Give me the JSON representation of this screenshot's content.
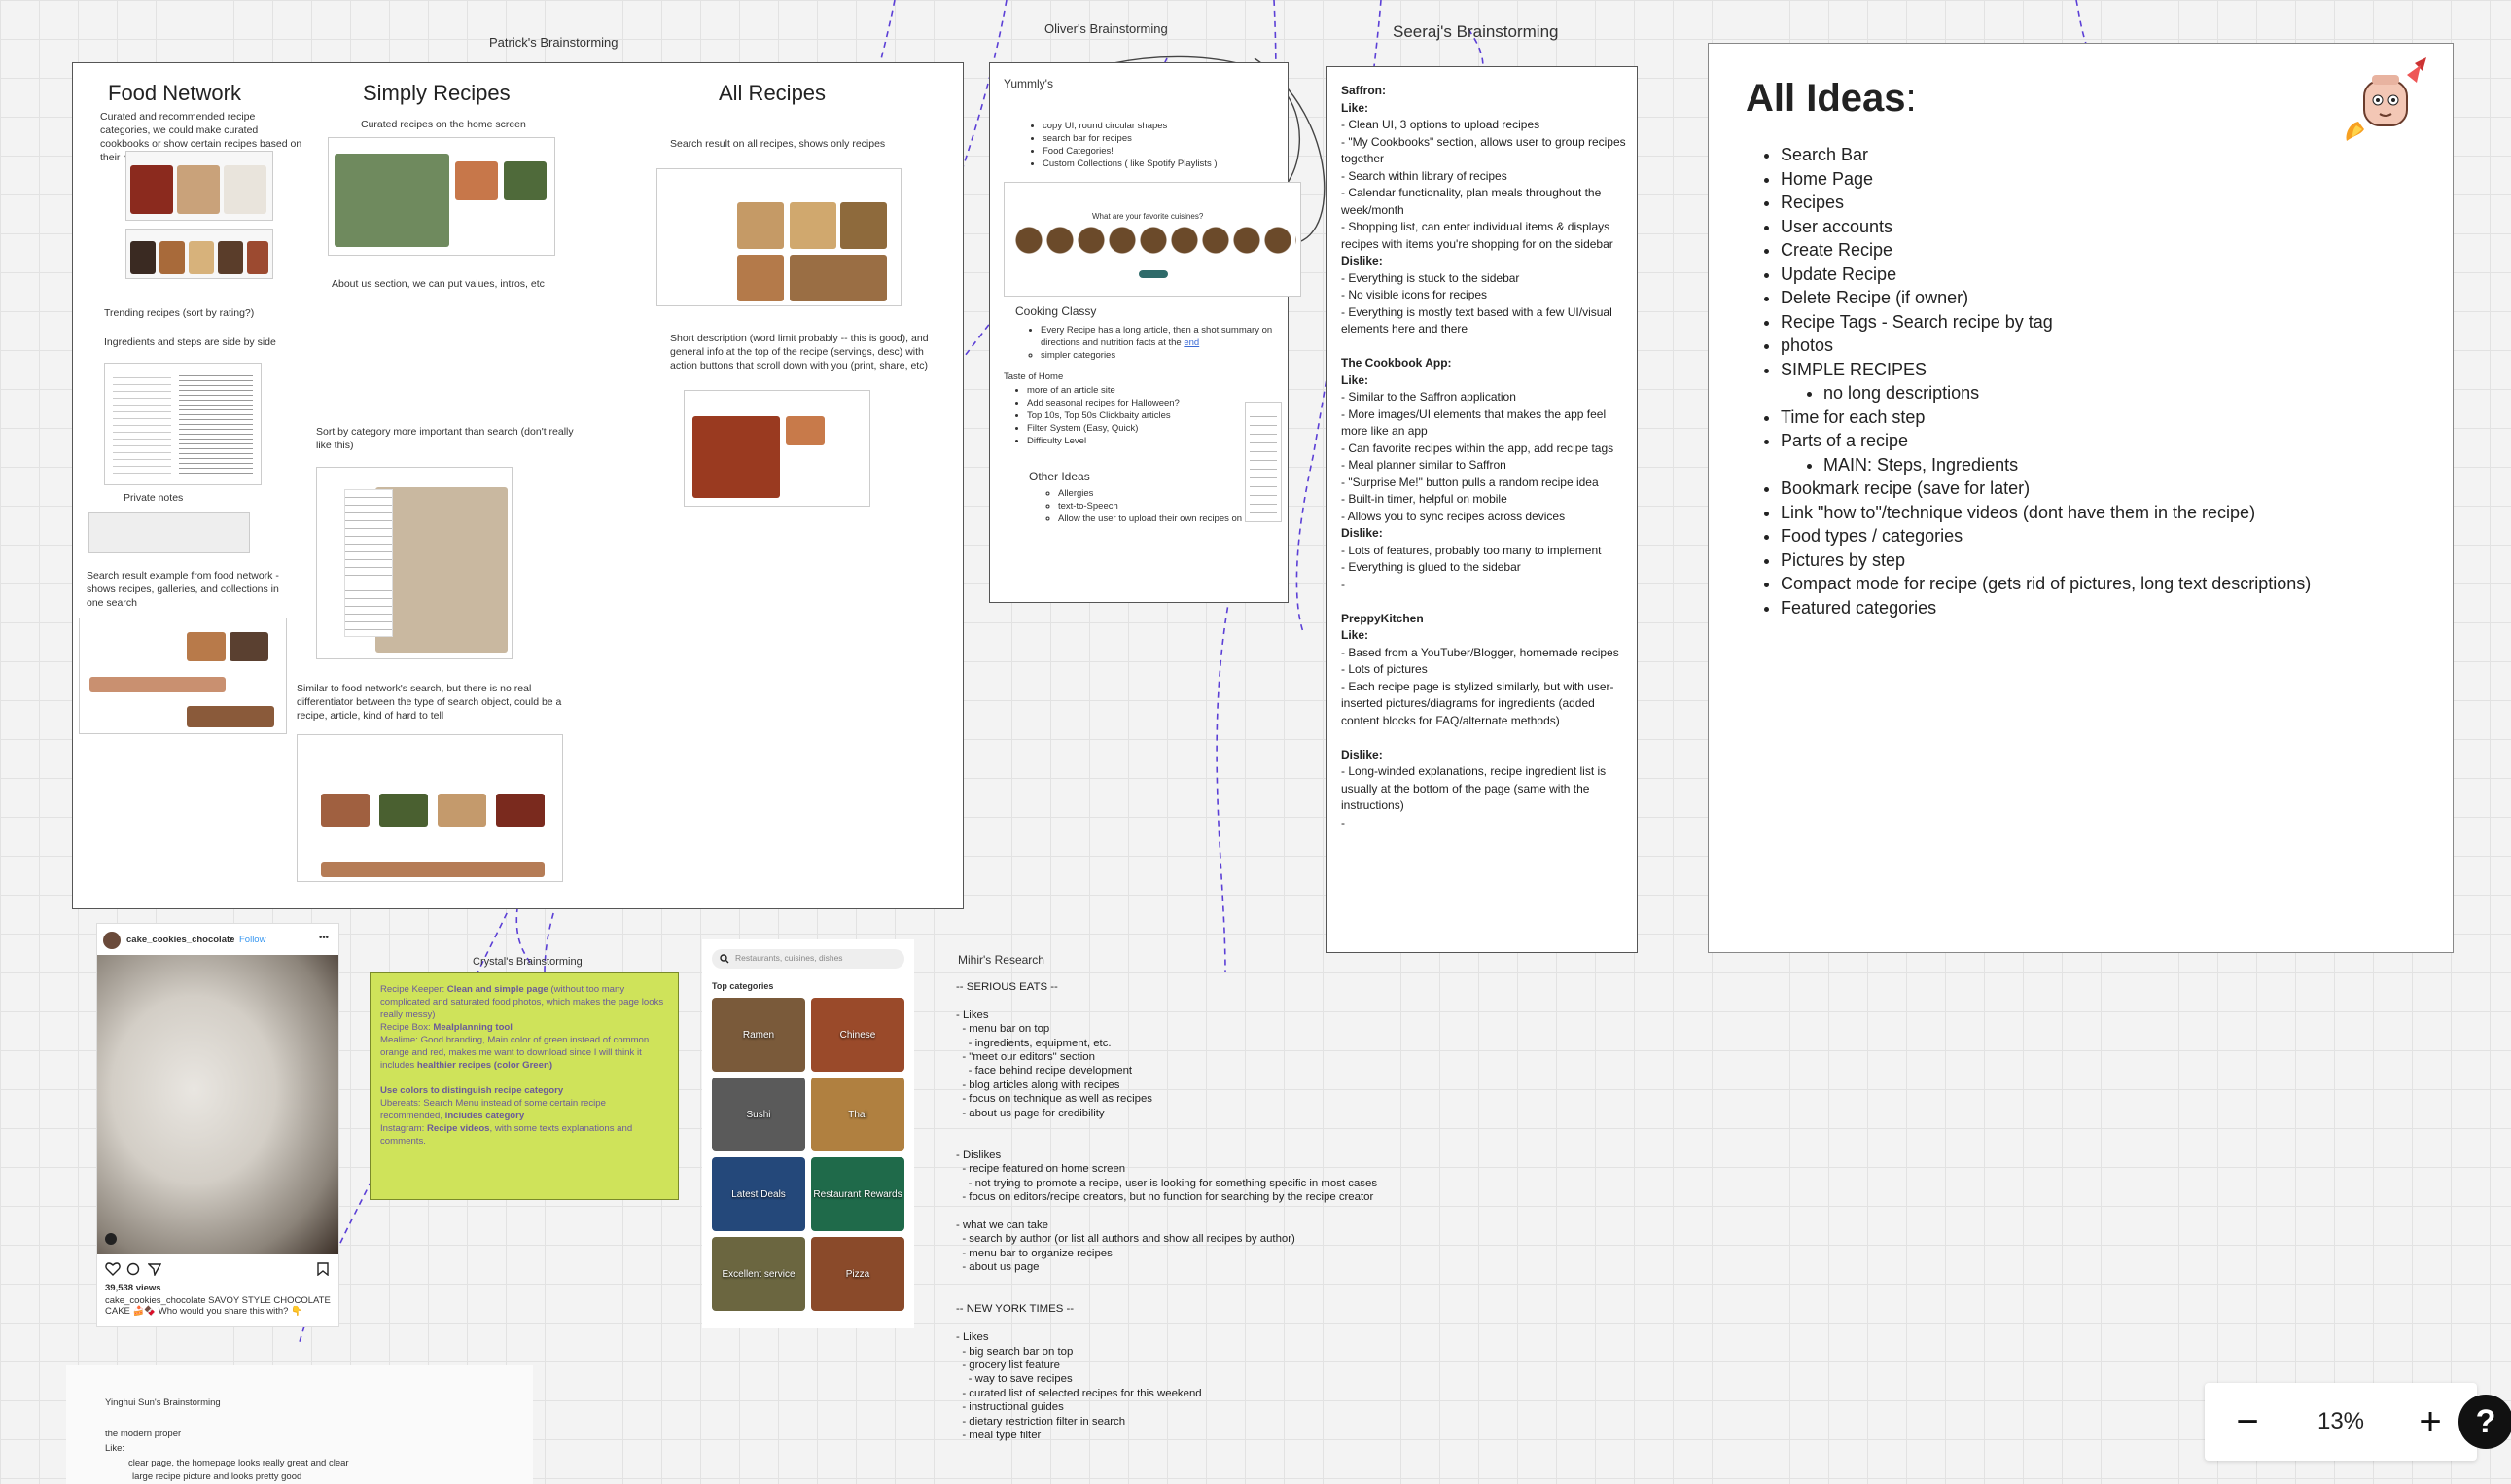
{
  "labels": {
    "patrick": "Patrick's Brainstorming",
    "oliver": "Oliver's Brainstorming",
    "seeraj": "Seeraj's Brainstorming",
    "crystal": "Crystal's Brainstorming",
    "mihir": "Mihir's Research",
    "yinghui": "Yinghui Sun's Brainstorming"
  },
  "patrick": {
    "food_network": {
      "title": "Food Network",
      "desc": "Curated and recommended recipe categories, we could make curated cookbooks or show certain recipes based on their rating",
      "note_trending": "Trending recipes (sort by rating?)",
      "note_ingredients": "Ingredients and steps are side by side",
      "note_private": "Private notes",
      "note_search": "Search result example from food network - shows recipes, galleries, and collections in one search"
    },
    "simply_recipes": {
      "title": "Simply Recipes",
      "desc": "Curated recipes on the home screen",
      "note_about": "About us section, we can put values, intros, etc",
      "note_sort": "Sort by category more important than search (don't really like this)",
      "note_similar": "Similar to food network's search, but there is no real differentiator between the type of search object, could be a recipe, article, kind of hard to tell"
    },
    "all_recipes": {
      "title": "All Recipes",
      "desc": "Search result on all recipes, shows only recipes",
      "note_short": "Short description (word limit probably -- this is good), and general info at the top of the recipe (servings, desc) with action buttons that scroll down with you (print, share, etc)"
    }
  },
  "oliver": {
    "yummly_title": "Yummly's",
    "yummly_items": [
      "copy UI, round circular shapes",
      "search bar for recipes",
      "Food Categories!",
      "Custom Collections ( like Spotify Playlists )"
    ],
    "screenshot_text": "What are your favorite cuisines?",
    "cooking_title": "Cooking Classy",
    "cooking_item_a": "Every Recipe has a long article, then a shot summary on directions and nutrition facts at the ",
    "cooking_item_link": "end",
    "cooking_item_b": "simpler categories",
    "taste_title": "Taste of Home",
    "taste_items": [
      "more of an article site",
      "Add seasonal recipes for Halloween?",
      "Top 10s, Top 50s Clickbaity articles",
      "Filter System (Easy, Quick)",
      "Difficulty Level"
    ],
    "other_title": "Other Ideas",
    "other_items": [
      "Allergies",
      "text-to-Speech",
      "Allow the user to upload their own recipes on site"
    ]
  },
  "seeraj": {
    "text": "<b>Saffron:</b>\n<b>Like:</b>\n- Clean UI, 3 options to upload recipes\n- \"My Cookbooks\" section, allows user to group recipes together\n- Search within library of recipes\n- Calendar functionality, plan meals throughout the week/month\n- Shopping list, can enter individual items & displays recipes with items you're shopping for on the sidebar\n<b>Dislike:</b>\n- Everything is stuck to the sidebar\n- No visible icons for recipes\n- Everything is mostly text based with a few UI/visual elements here and there\n\n<b>The Cookbook App:</b>\n<b>Like:</b>\n- Similar to the Saffron application\n- More images/UI elements that makes the app feel more like an app\n- Can favorite recipes within the app, add recipe tags\n- Meal planner similar to Saffron\n- \"Surprise Me!\" button pulls a random recipe idea\n- Built-in timer, helpful on mobile\n- Allows you to sync recipes across devices\n<b>Dislike:</b>\n- Lots of features, probably too many to implement\n- Everything is glued to the sidebar\n-\n\n<b>PreppyKitchen</b>\n<b>Like:</b>\n- Based from a YouTuber/Blogger, homemade recipes\n- Lots of pictures\n- Each recipe page is stylized similarly, but with user-inserted pictures/diagrams for ingredients (added content blocks for FAQ/alternate methods)\n\n<b>Dislike:</b>\n- Long-winded explanations, recipe ingredient list is usually at the bottom of the page (same with the instructions)\n-"
  },
  "all_ideas": {
    "title": "All Ideas",
    "colon": ":",
    "items": [
      {
        "text": "Search Bar",
        "level": 1
      },
      {
        "text": "Home Page",
        "level": 1
      },
      {
        "text": "Recipes",
        "level": 1
      },
      {
        "text": "User accounts",
        "level": 1
      },
      {
        "text": "Create Recipe",
        "level": 1
      },
      {
        "text": "Update Recipe",
        "level": 1
      },
      {
        "text": "Delete Recipe (if owner)",
        "level": 1
      },
      {
        "text": "Recipe Tags - Search recipe by tag",
        "level": 1
      },
      {
        "text": "photos",
        "level": 1
      },
      {
        "text": "SIMPLE RECIPES",
        "level": 1
      },
      {
        "text": "no long descriptions",
        "level": 2
      },
      {
        "text": "Time for each step",
        "level": 1
      },
      {
        "text": "Parts of a recipe",
        "level": 1
      },
      {
        "text": "MAIN: Steps, Ingredients",
        "level": 2
      },
      {
        "text": "Bookmark recipe (save for later)",
        "level": 1
      },
      {
        "text": "Link \"how to\"/technique videos (dont have them in the recipe)",
        "level": 1
      },
      {
        "text": "Food types / categories",
        "level": 1
      },
      {
        "text": "Pictures by step",
        "level": 1
      },
      {
        "text": "Compact mode for recipe (gets rid of pictures, long text descriptions)",
        "level": 1
      },
      {
        "text": "Featured categories",
        "level": 1
      }
    ]
  },
  "instagram": {
    "username": "cake_cookies_chocolate",
    "dot": "•",
    "follow": "Follow",
    "more": "•••",
    "views": "39,538 views",
    "caption": "cake_cookies_chocolate SAVOY STYLE CHOCOLATE CAKE 🍰🍫 Who would you share this with? 👇"
  },
  "crystal": {
    "text": "Recipe Keeper: <b>Clean and simple page</b> (without too many complicated and saturated food photos, which makes the page looks really messy)\nRecipe Box: <b>Mealplanning tool</b>\nMealime: Good branding, Main color of green instead of common orange and red, makes me want to download since I will think it includes <b>healthier recipes (color Green)</b>\n\n<b>Use colors to distinguish recipe category</b>\nUbereats: Search Menu instead of some certain recipe recommended, <b>includes category</b>\nInstagram: <b>Recipe videos</b>, with some texts explanations and comments."
  },
  "ubereats": {
    "search_placeholder": "Restaurants, cuisines, dishes",
    "top_categories": "Top categories",
    "tiles": [
      "Ramen",
      "Chinese",
      "Sushi",
      "Thai",
      "Latest Deals",
      "Restaurant Rewards",
      "Excellent service",
      "Pizza"
    ]
  },
  "mihir": {
    "text": "-- SERIOUS EATS --\n\n- Likes\n  - menu bar on top\n    - ingredients, equipment, etc.\n  - \"meet our editors\" section\n    - face behind recipe development\n  - blog articles along with recipes\n  - focus on technique as well as recipes\n  - about us page for credibility\n\n\n- Dislikes\n  - recipe featured on home screen\n    - not trying to promote a recipe, user is looking for something specific in most cases\n  - focus on editors/recipe creators, but no function for searching by the recipe creator\n\n- what we can take\n  - search by author (or list all authors and show all recipes by author)\n  - menu bar to organize recipes\n  - about us page\n\n\n-- NEW YORK TIMES --\n\n- Likes\n  - big search bar on top\n  - grocery list feature\n    - way to save recipes\n  - curated list of selected recipes for this weekend\n  - instructional guides\n  - dietary restriction filter in search\n  - meal type filter"
  },
  "yinghui": {
    "title": "Yinghui Sun's Brainstorming",
    "line1": "the modern proper",
    "line2": "Like:",
    "line3": "clear page, the homepage looks really great and clear",
    "line4": "large recipe picture and looks pretty good"
  },
  "zoom": {
    "minus": "−",
    "level": "13%",
    "plus": "+",
    "help": "?"
  },
  "colors": {
    "canvas_bg": "#f3f3f3",
    "crystal_note": "#cfe35a",
    "connector": "#5b3fd6",
    "link": "#3a6ad4"
  }
}
